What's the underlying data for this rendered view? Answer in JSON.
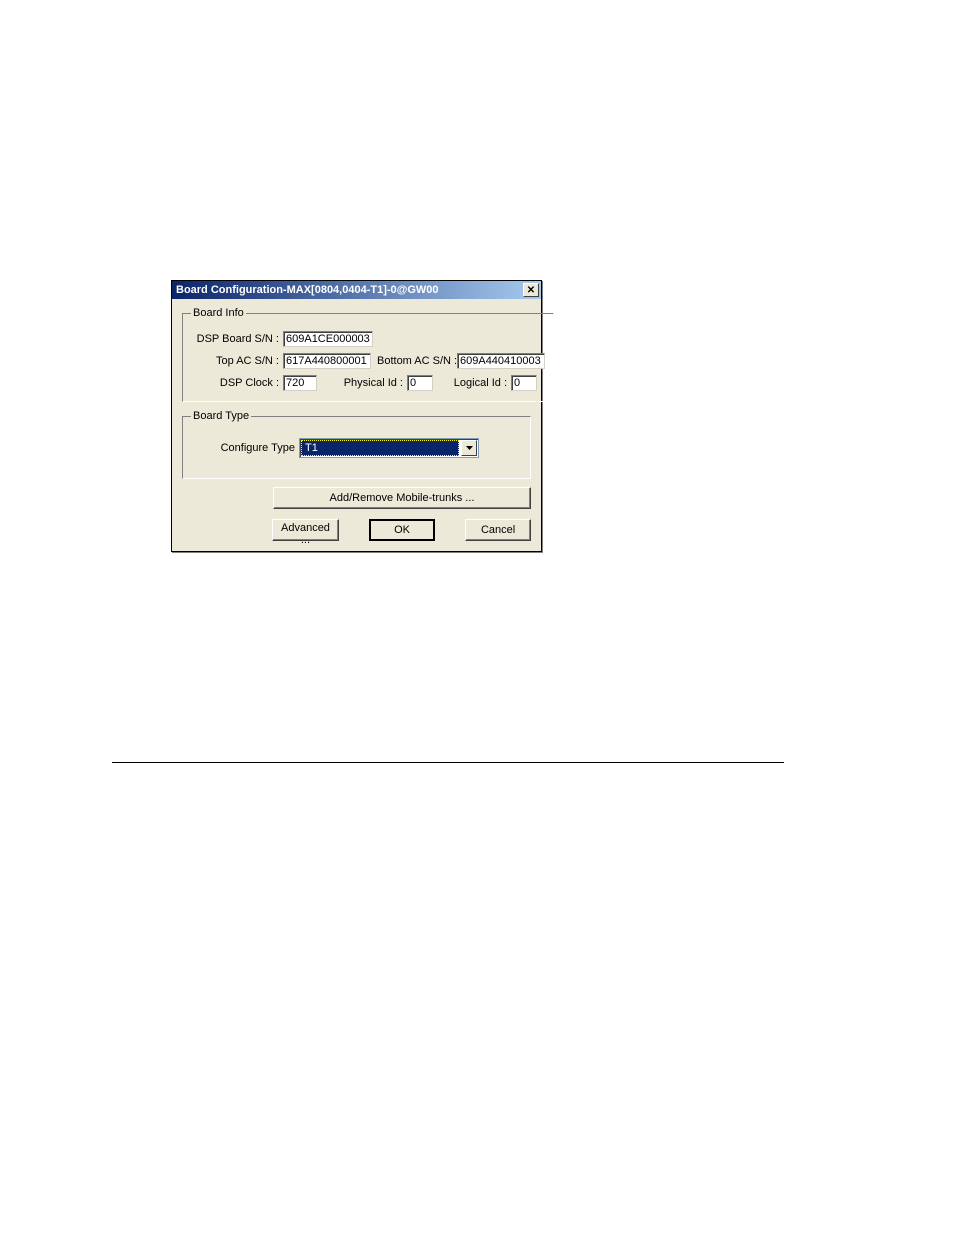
{
  "dialog": {
    "title": "Board Configuration-MAX[0804,0404-T1]-0@GW00",
    "boardInfo": {
      "legend": "Board Info",
      "dspBoardSnLabel": "DSP Board S/N :",
      "dspBoardSnValue": "609A1CE000003",
      "topAcSnLabel": "Top AC S/N :",
      "topAcSnValue": "617A440800001",
      "bottomAcSnLabel": "Bottom AC S/N :",
      "bottomAcSnValue": "609A440410003",
      "dspClockLabel": "DSP Clock :",
      "dspClockValue": "720",
      "physicalIdLabel": "Physical Id :",
      "physicalIdValue": "0",
      "logicalIdLabel": "Logical Id :",
      "logicalIdValue": "0"
    },
    "boardType": {
      "legend": "Board Type",
      "configureTypeLabel": "Configure Type",
      "configureTypeValue": "T1"
    },
    "buttons": {
      "addRemove": "Add/Remove Mobile-trunks ...",
      "advanced": "Advanced ...",
      "ok": "OK",
      "cancel": "Cancel"
    }
  }
}
